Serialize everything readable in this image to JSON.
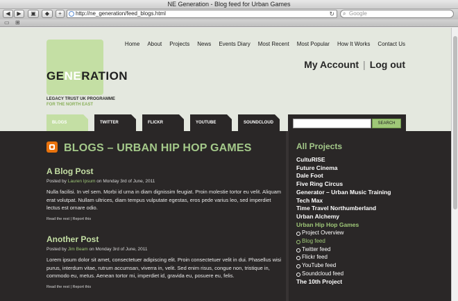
{
  "window": {
    "title": "NE Generation - Blog feed for Urban Games"
  },
  "browser": {
    "url": "http://ne_generation/feed_blogs.html",
    "search_placeholder": "Google"
  },
  "nav": {
    "items": [
      "Home",
      "About",
      "Projects",
      "News",
      "Events Diary",
      "Most Recent",
      "Most Popular",
      "How It Works",
      "Contact Us"
    ]
  },
  "account": {
    "my_account": "My Account",
    "logout": "Log out"
  },
  "logo": {
    "word_pre": "GE",
    "word_hl": "NE",
    "word_post": "RATION",
    "line1": "LEGACY TRUST UK PROGRAMME",
    "line2": "FOR THE NORTH EAST"
  },
  "tabs": [
    "BLOGS",
    "TWITTER",
    "FLICKR",
    "YOUTUBE",
    "SOUNDCLOUD"
  ],
  "search": {
    "button": "SEARCH"
  },
  "section": {
    "title": "BLOGS – URBAN HIP HOP GAMES"
  },
  "posts": [
    {
      "title": "A Blog Post",
      "posted_by": "Posted by",
      "author": "Lauren Ipsum",
      "date": "on Monday 3rd of June, 2011",
      "body": "Nulla facilisi. In vel sem. Morbi id urna in diam dignissim feugiat. Proin molestie tortor eu velit. Aliquam erat volutpat. Nullam ultrices, diam tempus vulputate egestas, eros pede varius leo, sed imperdiet lectus est ornare odio.",
      "read_more": "Read the rest",
      "report": "Report this"
    },
    {
      "title": "Another Post",
      "posted_by": "Posted by",
      "author": "Jim Beam",
      "date": "on Monday 3rd of June, 2011",
      "body": "Lorem ipsum dolor sit amet, consectetuer adipiscing elit. Proin consectetuer velit in dui. Phasellus wisi purus, interdum vitae, rutrum accumsan, viverra in, velit. Sed enim risus, congue non, tristique in, commodo eu, metus. Aenean tortor mi, imperdiet id, gravida eu, posuere eu, felis.",
      "read_more": "Read the rest",
      "report": "Report this"
    }
  ],
  "sidebar": {
    "title": "All Projects",
    "items": [
      {
        "label": "CultuRISE"
      },
      {
        "label": "Future Cinema"
      },
      {
        "label": "Dale Foot"
      },
      {
        "label": "Five Ring Circus"
      },
      {
        "label": "Generator – Urban Music Training"
      },
      {
        "label": "Tech Max"
      },
      {
        "label": "Time Travel Northumberland"
      },
      {
        "label": "Urban Alchemy"
      },
      {
        "label": "Urban Hip Hop Games"
      },
      {
        "label": "Project Overview"
      },
      {
        "label": "Blog feed"
      },
      {
        "label": "Twitter feed"
      },
      {
        "label": "Flickr feed"
      },
      {
        "label": "YouTube feed"
      },
      {
        "label": "Soundcloud feed"
      },
      {
        "label": "The 10th Project"
      }
    ]
  },
  "colors": {
    "accent_green": "#c4dfa4",
    "link_green": "#9fc878",
    "dark_panel": "#2a2727",
    "page_bg": "#e4e8df"
  }
}
